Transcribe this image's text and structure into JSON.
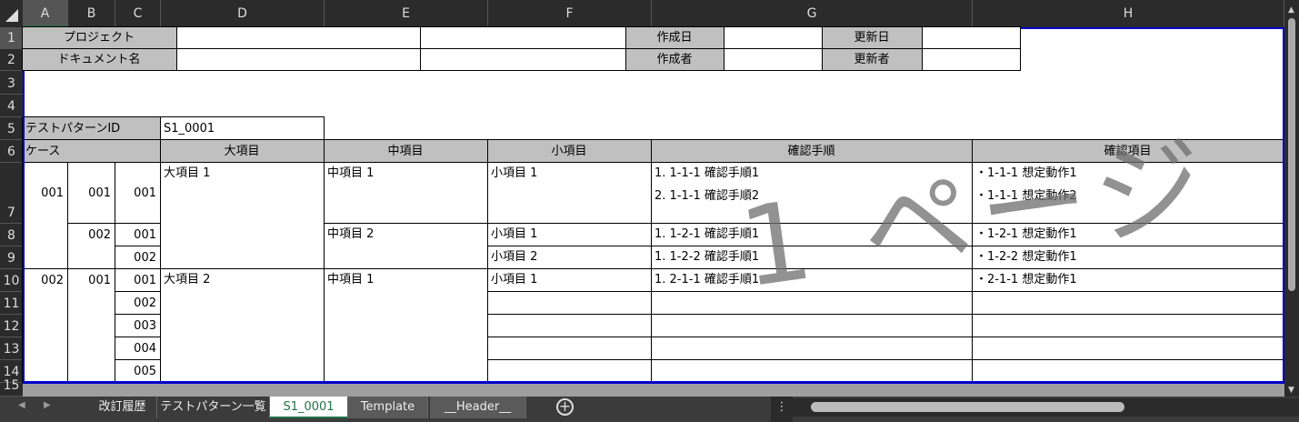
{
  "columns": [
    "A",
    "B",
    "C",
    "D",
    "E",
    "F",
    "G",
    "H"
  ],
  "rows": [
    "1",
    "2",
    "3",
    "4",
    "5",
    "6",
    "7",
    "8",
    "9",
    "10",
    "11",
    "12",
    "13",
    "14",
    "15"
  ],
  "header_block": {
    "project_label": "プロジェクト",
    "document_label": "ドキュメント名",
    "created_date_label": "作成日",
    "updated_date_label": "更新日",
    "author_label": "作成者",
    "updater_label": "更新者"
  },
  "pattern": {
    "label": "テストパターンID",
    "value": "S1_0001"
  },
  "table_header": {
    "case": "ケース",
    "major": "大項目",
    "middle": "中項目",
    "minor": "小項目",
    "steps": "確認手順",
    "checks": "確認項目"
  },
  "cases": {
    "a7": "001",
    "b7": "001",
    "c7": "001",
    "b8": "002",
    "c8": "001",
    "c9": "002",
    "a10": "002",
    "b10": "001",
    "c10": "001",
    "c11": "002",
    "c12": "003",
    "c13": "004",
    "c14": "005",
    "d7": "大項目 1",
    "d10": "大項目 2",
    "e7": "中項目 1",
    "e8": "中項目 2",
    "e10": "中項目 1",
    "f7": "小項目 1",
    "f8": "小項目 1",
    "f9": "小項目 2",
    "f10": "小項目 1",
    "g7a": "1. 1-1-1 確認手順1",
    "g7b": "2. 1-1-1 確認手順2",
    "g8": "1. 1-2-1 確認手順1",
    "g9": "1. 1-2-2 確認手順1",
    "g10": "1. 2-1-1 確認手順1",
    "h7a": "・1-1-1 想定動作1",
    "h7b": "・1-1-1 想定動作2",
    "h8": "・1-2-1 想定動作1",
    "h9": "・1-2-2 想定動作1",
    "h10": "・2-1-1 想定動作1"
  },
  "watermark": "1 ページ",
  "tabs": [
    "改訂履歴",
    "テストパターン一覧",
    "S1_0001",
    "Template",
    "__Header__"
  ],
  "active_tab": "S1_0001",
  "colors": {
    "page_break": "#0000cc",
    "accent": "#217346",
    "header_grey": "#c0c0c0"
  }
}
